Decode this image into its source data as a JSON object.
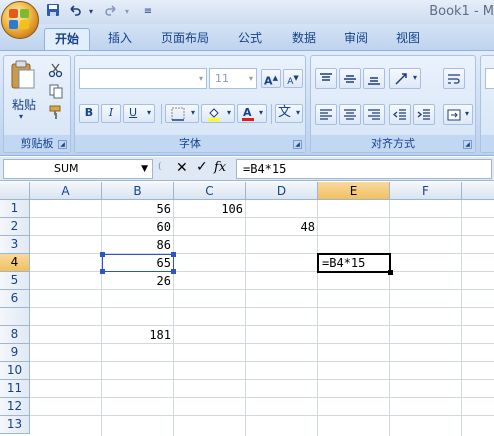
{
  "window": {
    "title": "Book1 - M"
  },
  "quick_access": {
    "save_icon": "save-icon",
    "undo_icon": "undo-icon",
    "redo_icon": "redo-icon",
    "customize_icon": "customize-icon"
  },
  "tabs": [
    "开始",
    "插入",
    "页面布局",
    "公式",
    "数据",
    "审阅",
    "视图"
  ],
  "active_tab": "开始",
  "ribbon": {
    "clipboard": {
      "label": "剪贴板",
      "paste_label": "粘贴"
    },
    "font": {
      "label": "字体",
      "font_size": "11",
      "bold": "B",
      "italic": "I",
      "underline": "U",
      "grow": "A",
      "shrink": "A",
      "color_a": "A",
      "phonetic": "wén"
    },
    "alignment": {
      "label": "对齐方式"
    }
  },
  "formula_bar": {
    "name_box": "SUM",
    "cancel": "✕",
    "enter": "✓",
    "fx": "fx",
    "formula": "=B4*15"
  },
  "columns": [
    "A",
    "B",
    "C",
    "D",
    "E",
    "F"
  ],
  "rows": [
    "1",
    "2",
    "3",
    "4",
    "5",
    "6",
    "8",
    "9",
    "10",
    "11",
    "12",
    "13"
  ],
  "cells": {
    "B1": "56",
    "C1": "106",
    "B2": "60",
    "D2": "48",
    "B3": "86",
    "B4": "65",
    "E4": "=B4*15",
    "B5": "26",
    "B8": "181"
  },
  "selection": {
    "active_column": "E",
    "active_row": "4",
    "copy_source": "B4"
  }
}
